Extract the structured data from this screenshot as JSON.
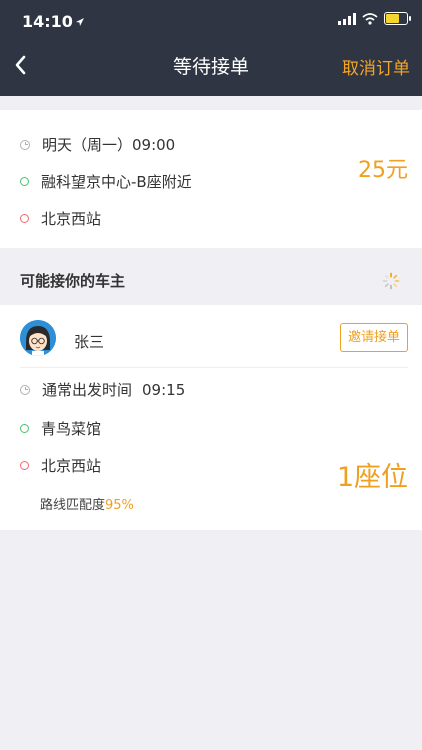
{
  "status": {
    "time": "14:10"
  },
  "header": {
    "title": "等待接单",
    "cancel_label": "取消订单"
  },
  "order": {
    "time": "明天（周一）09:00",
    "start": "融科望京中心-B座附近",
    "end": "北京西站",
    "price": "25元"
  },
  "drivers_section": {
    "title": "可能接你的车主"
  },
  "driver": {
    "name": "张三",
    "invite_label": "邀请接单",
    "usual_time_label": "通常出发时间",
    "usual_time": "09:15",
    "start": "青鸟菜馆",
    "end": "北京西站",
    "seats": "1座位",
    "match_label": "路线匹配度",
    "match_value": "95%"
  },
  "colors": {
    "accent": "#f0a020",
    "header_bg": "#2f3542",
    "start_dot": "#48c26b",
    "end_dot": "#ef6a6a"
  }
}
